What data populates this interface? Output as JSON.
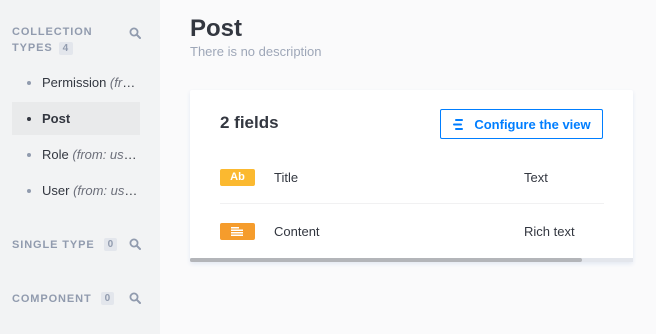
{
  "sidebar": {
    "collection_types": {
      "title_line1": "COLLECTION",
      "title_line2": "TYPES",
      "count": "4",
      "items": [
        {
          "label": "Permission",
          "sub": "(from: users-permissions)",
          "active": false
        },
        {
          "label": "Post",
          "sub": "",
          "active": true
        },
        {
          "label": "Role",
          "sub": "(from: users-permissions)",
          "active": false
        },
        {
          "label": "User",
          "sub": "(from: users-permissions)",
          "active": false
        }
      ]
    },
    "single_types": {
      "title": "SINGLE TYPE",
      "count": "0"
    },
    "components": {
      "title": "COMPONENT",
      "count": "0"
    }
  },
  "main": {
    "title": "Post",
    "description": "There is no description",
    "card": {
      "fields_count_label": "2 fields",
      "configure_button": "Configure the view",
      "fields": [
        {
          "name": "Title",
          "type": "Text",
          "icon_text": "Ab",
          "icon": "text-icon",
          "color": "#fbb930"
        },
        {
          "name": "Content",
          "type": "Rich text",
          "icon_text": "",
          "icon": "rich-text-icon",
          "color": "#f59c2c"
        }
      ]
    }
  },
  "colors": {
    "accent": "#007eff",
    "sidebar_bg": "#f2f3f4"
  }
}
